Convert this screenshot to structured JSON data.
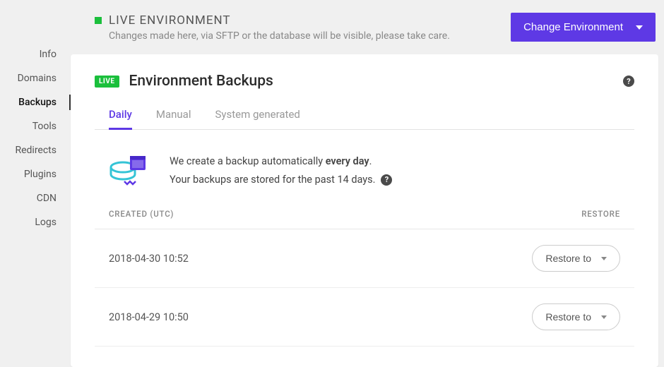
{
  "sidebar": {
    "items": [
      {
        "label": "Info"
      },
      {
        "label": "Domains"
      },
      {
        "label": "Backups"
      },
      {
        "label": "Tools"
      },
      {
        "label": "Redirects"
      },
      {
        "label": "Plugins"
      },
      {
        "label": "CDN"
      },
      {
        "label": "Logs"
      }
    ]
  },
  "topbar": {
    "title": "LIVE ENVIRONMENT",
    "subtitle": "Changes made here, via SFTP or the database will be visible, please take care.",
    "change_btn": "Change Environment"
  },
  "panel": {
    "badge": "LIVE",
    "title": "Environment Backups",
    "tabs": [
      {
        "label": "Daily"
      },
      {
        "label": "Manual"
      },
      {
        "label": "System generated"
      }
    ],
    "info_prefix": "We create a backup automatically ",
    "info_bold": "every day",
    "info_suffix": ".",
    "info_line2": "Your backups are stored for the past 14 days.",
    "columns": {
      "created": "CREATED (UTC)",
      "restore": "RESTORE"
    },
    "rows": [
      {
        "date": "2018-04-30 10:52",
        "action": "Restore to"
      },
      {
        "date": "2018-04-29 10:50",
        "action": "Restore to"
      }
    ]
  }
}
